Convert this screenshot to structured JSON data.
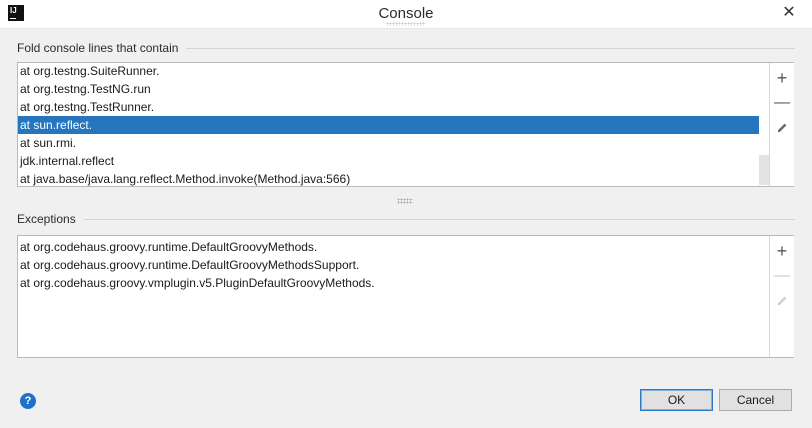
{
  "window": {
    "title": "Console",
    "app_icon_text": "IJ",
    "close_glyph": "✕"
  },
  "fold_section": {
    "header": "Fold console lines that contain",
    "items": [
      "at org.testng.SuiteRunner.",
      "at org.testng.TestNG.run",
      "at org.testng.TestRunner.",
      "at sun.reflect.",
      "at sun.rmi.",
      "jdk.internal.reflect",
      "at java.base/java.lang.reflect.Method.invoke(Method.java:566)"
    ],
    "selected_index": 3,
    "tools": {
      "add": "+",
      "remove": "—"
    }
  },
  "exceptions_section": {
    "header": "Exceptions",
    "items": [
      "at org.codehaus.groovy.runtime.DefaultGroovyMethods.",
      "at org.codehaus.groovy.runtime.DefaultGroovyMethodsSupport.",
      "at org.codehaus.groovy.vmplugin.v5.PluginDefaultGroovyMethods."
    ],
    "tools": {
      "add": "+",
      "remove": "—"
    }
  },
  "footer": {
    "help_glyph": "?",
    "ok_label": "OK",
    "cancel_label": "Cancel"
  },
  "colors": {
    "selection": "#2675bf",
    "help_icon": "#1f72c7",
    "default_button_border": "#2a78c4"
  }
}
